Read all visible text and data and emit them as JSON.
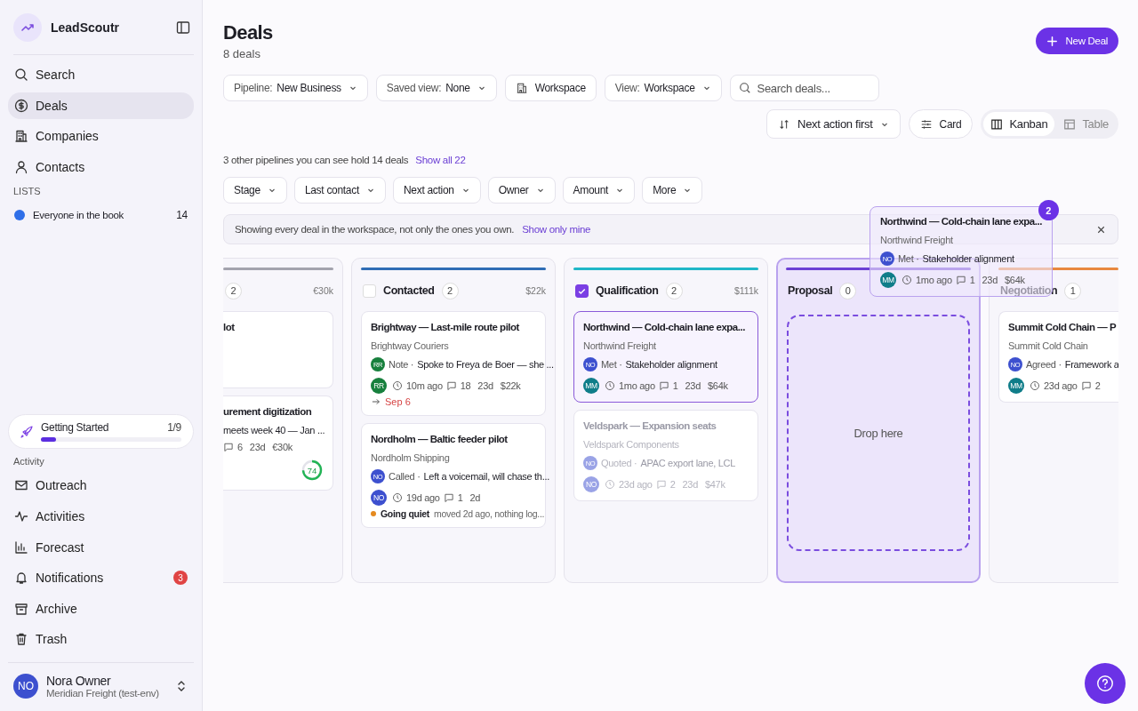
{
  "sidebar": {
    "brand": "LeadScoutr",
    "nav": [
      {
        "label": "Search",
        "selected": false
      },
      {
        "label": "Deals",
        "selected": true
      },
      {
        "label": "Companies",
        "selected": false
      },
      {
        "label": "Contacts",
        "selected": false
      }
    ],
    "lists_heading": "LISTS",
    "lists": [
      {
        "label": "Everyone in the book",
        "count": "14",
        "color": "#2f6fe8"
      }
    ],
    "getting_started": {
      "label": "Getting Started",
      "progress": "1/9",
      "level": 0.11
    },
    "activity_heading": "Activity",
    "activity_nav": [
      {
        "label": "Outreach",
        "selected": false
      },
      {
        "label": "Activities",
        "selected": false
      },
      {
        "label": "Forecast",
        "selected": false
      },
      {
        "label": "Notifications",
        "badge": "3",
        "selected": false
      },
      {
        "label": "Archive",
        "selected": false
      },
      {
        "label": "Trash",
        "selected": false
      }
    ],
    "user": {
      "initials": "NO",
      "name": "Nora Owner",
      "org": "Meridian Freight (test-env)"
    }
  },
  "header": {
    "title": "Deals",
    "subtitle": "8 deals",
    "new_button": "New Deal"
  },
  "toolbar": {
    "pipeline": {
      "label": "Pipeline:",
      "value": "New Business"
    },
    "saved_view": {
      "label": "Saved view:",
      "value": "None"
    },
    "scope_button": "Workspace",
    "view": {
      "label": "View:",
      "value": "Workspace"
    },
    "search": {
      "placeholder": "Search deals..."
    },
    "sort": "Next action first",
    "card_button": "Card",
    "layouts": [
      {
        "label": "Kanban",
        "selected": true
      },
      {
        "label": "Table",
        "selected": false
      }
    ]
  },
  "pipelines_note": {
    "text": "3 other pipelines you can see hold 14 deals",
    "link": "Show all 22"
  },
  "filters": [
    "Stage",
    "Last contact",
    "Next action",
    "Owner",
    "Amount",
    "More"
  ],
  "banner": {
    "text": "Showing every deal in the workspace, not only the ones you own.",
    "link": "Show only mine"
  },
  "columns": [
    {
      "count": "2",
      "amount": "€30k",
      "color": "#a3a3ad",
      "drop_target": false,
      "cards": [
        {
          "title": "lot",
          "selected": false,
          "dimmed": false
        },
        {
          "title": "urement digitization",
          "selected": false,
          "dimmed": false,
          "activity": {
            "text": "meets week 40 — Jan ..."
          },
          "meta": {
            "comments": "6",
            "age": "23d",
            "amount": "€30k"
          },
          "score": {
            "value": "74"
          }
        }
      ]
    },
    {
      "name": "Contacted",
      "checked": false,
      "count": "2",
      "amount": "$22k",
      "color": "#2f6db5",
      "drop_target": false,
      "cards": [
        {
          "title": "Brightway — Last-mile route pilot",
          "company": "Brightway Couriers",
          "selected": false,
          "dimmed": false,
          "activity": {
            "avatar": {
              "initials": "RR",
              "color": "#17803d"
            },
            "verb": "Note ·",
            "text": "Spoke to Freya de Boer — she ..."
          },
          "meta": {
            "owner": {
              "initials": "RR",
              "color": "#17803d"
            },
            "time": "10m ago",
            "comments": "18",
            "age": "23d",
            "amount": "$22k"
          },
          "due": "Sep 6"
        },
        {
          "title": "Nordholm — Baltic feeder pilot",
          "company": "Nordholm Shipping",
          "selected": false,
          "dimmed": false,
          "activity": {
            "avatar": {
              "initials": "NO",
              "color": "#3d50cf"
            },
            "verb": "Called ·",
            "text": "Left a voicemail, will chase th..."
          },
          "meta": {
            "owner": {
              "initials": "NO",
              "color": "#3d50cf"
            },
            "time": "19d ago",
            "comments": "1",
            "age": "2d"
          },
          "signal": {
            "label": "Going quiet",
            "text": "moved 2d ago, nothing log...",
            "color": "#e58a1f"
          }
        }
      ]
    },
    {
      "name": "Qualification",
      "checked": true,
      "count": "2",
      "amount": "$111k",
      "color": "#1fb7c7",
      "drop_target": false,
      "cards": [
        {
          "title": "Northwind — Cold-chain lane expa...",
          "company": "Northwind Freight",
          "selected": true,
          "dimmed": false,
          "activity": {
            "avatar": {
              "initials": "NO",
              "color": "#3d50cf"
            },
            "verb": "Met ·",
            "text": "Stakeholder alignment"
          },
          "meta": {
            "owner": {
              "initials": "MM",
              "color": "#0f7d89"
            },
            "time": "1mo ago",
            "comments": "1",
            "age": "23d",
            "amount": "$64k"
          }
        },
        {
          "title": "Veldspark — Expansion seats",
          "company": "Veldspark Components",
          "selected": false,
          "dimmed": true,
          "activity": {
            "avatar": {
              "initials": "NO",
              "color": "#9aa3e6"
            },
            "verb": "Quoted ·",
            "text": "APAC export lane, LCL"
          },
          "meta": {
            "owner": {
              "initials": "NO",
              "color": "#9aa3e6"
            },
            "time": "23d ago",
            "comments": "2",
            "age": "23d",
            "amount": "$47k"
          }
        }
      ]
    },
    {
      "name": "Proposal",
      "count": "0",
      "color": "#6b3fd4",
      "drop_target": true,
      "drop_label": "Drop here"
    },
    {
      "name": "Negotiation",
      "count": "1",
      "color": "#e8883f",
      "drop_target": false,
      "cards": [
        {
          "title": "Summit Cold Chain — P",
          "company": "Summit Cold Chain",
          "selected": false,
          "dimmed": false,
          "activity": {
            "avatar": {
              "initials": "NO",
              "color": "#3d50cf"
            },
            "verb": "Agreed ·",
            "text": "Framework a"
          },
          "meta": {
            "owner": {
              "initials": "MM",
              "color": "#0f7d89"
            },
            "time": "23d ago",
            "comments": "2"
          }
        }
      ]
    }
  ],
  "drag_preview": {
    "count": "2",
    "title": "Northwind — Cold-chain lane expa...",
    "company": "Northwind Freight",
    "activity": {
      "avatar": {
        "initials": "NO",
        "color": "#3d50cf"
      },
      "verb": "Met ·",
      "text": "Stakeholder alignment"
    },
    "meta": {
      "owner": {
        "initials": "MM",
        "color": "#0f7d89"
      },
      "time": "1mo ago",
      "comments": "1",
      "age": "23d",
      "amount": "$64k"
    }
  }
}
